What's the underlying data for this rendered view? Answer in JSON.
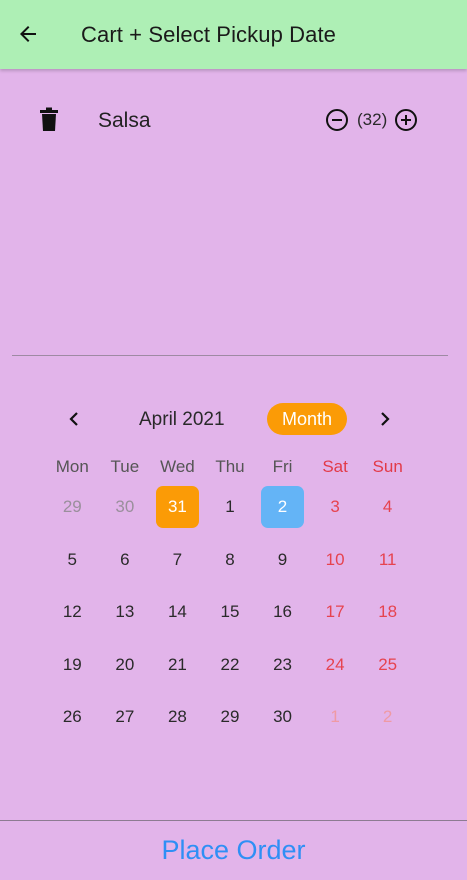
{
  "appbar": {
    "title": "Cart + Select Pickup Date",
    "back_icon": "arrow-left-icon"
  },
  "cart": {
    "items": [
      {
        "name": "Salsa",
        "quantity": "(32)",
        "delete_icon": "trash-icon",
        "decrement_icon": "minus-circle-icon",
        "increment_icon": "plus-circle-icon"
      }
    ]
  },
  "calendar": {
    "month_label": "April 2021",
    "format_button": "Month",
    "prev_icon": "chevron-left-icon",
    "next_icon": "chevron-right-icon",
    "weekdays": [
      "Mon",
      "Tue",
      "Wed",
      "Thu",
      "Fri",
      "Sat",
      "Sun"
    ],
    "today": "31",
    "selected": "2",
    "weeks": [
      [
        {
          "d": "29",
          "out": true
        },
        {
          "d": "30",
          "out": true
        },
        {
          "d": "31",
          "out": true,
          "today": true
        },
        {
          "d": "1"
        },
        {
          "d": "2",
          "selected": true
        },
        {
          "d": "3"
        },
        {
          "d": "4"
        }
      ],
      [
        {
          "d": "5"
        },
        {
          "d": "6"
        },
        {
          "d": "7"
        },
        {
          "d": "8"
        },
        {
          "d": "9"
        },
        {
          "d": "10"
        },
        {
          "d": "11"
        }
      ],
      [
        {
          "d": "12"
        },
        {
          "d": "13"
        },
        {
          "d": "14"
        },
        {
          "d": "15"
        },
        {
          "d": "16"
        },
        {
          "d": "17"
        },
        {
          "d": "18"
        }
      ],
      [
        {
          "d": "19"
        },
        {
          "d": "20"
        },
        {
          "d": "21"
        },
        {
          "d": "22"
        },
        {
          "d": "23"
        },
        {
          "d": "24"
        },
        {
          "d": "25"
        }
      ],
      [
        {
          "d": "26"
        },
        {
          "d": "27"
        },
        {
          "d": "28"
        },
        {
          "d": "29"
        },
        {
          "d": "30"
        },
        {
          "d": "1",
          "out": true
        },
        {
          "d": "2",
          "out": true
        }
      ]
    ]
  },
  "footer": {
    "place_order_label": "Place Order"
  },
  "colors": {
    "appbar_bg": "#aeefb5",
    "page_bg": "#e2b4ea",
    "today_bg": "#fb9b06",
    "selected_bg": "#64b4f6",
    "weekend_text": "#e6434f",
    "action_text": "#2f8ff5"
  }
}
